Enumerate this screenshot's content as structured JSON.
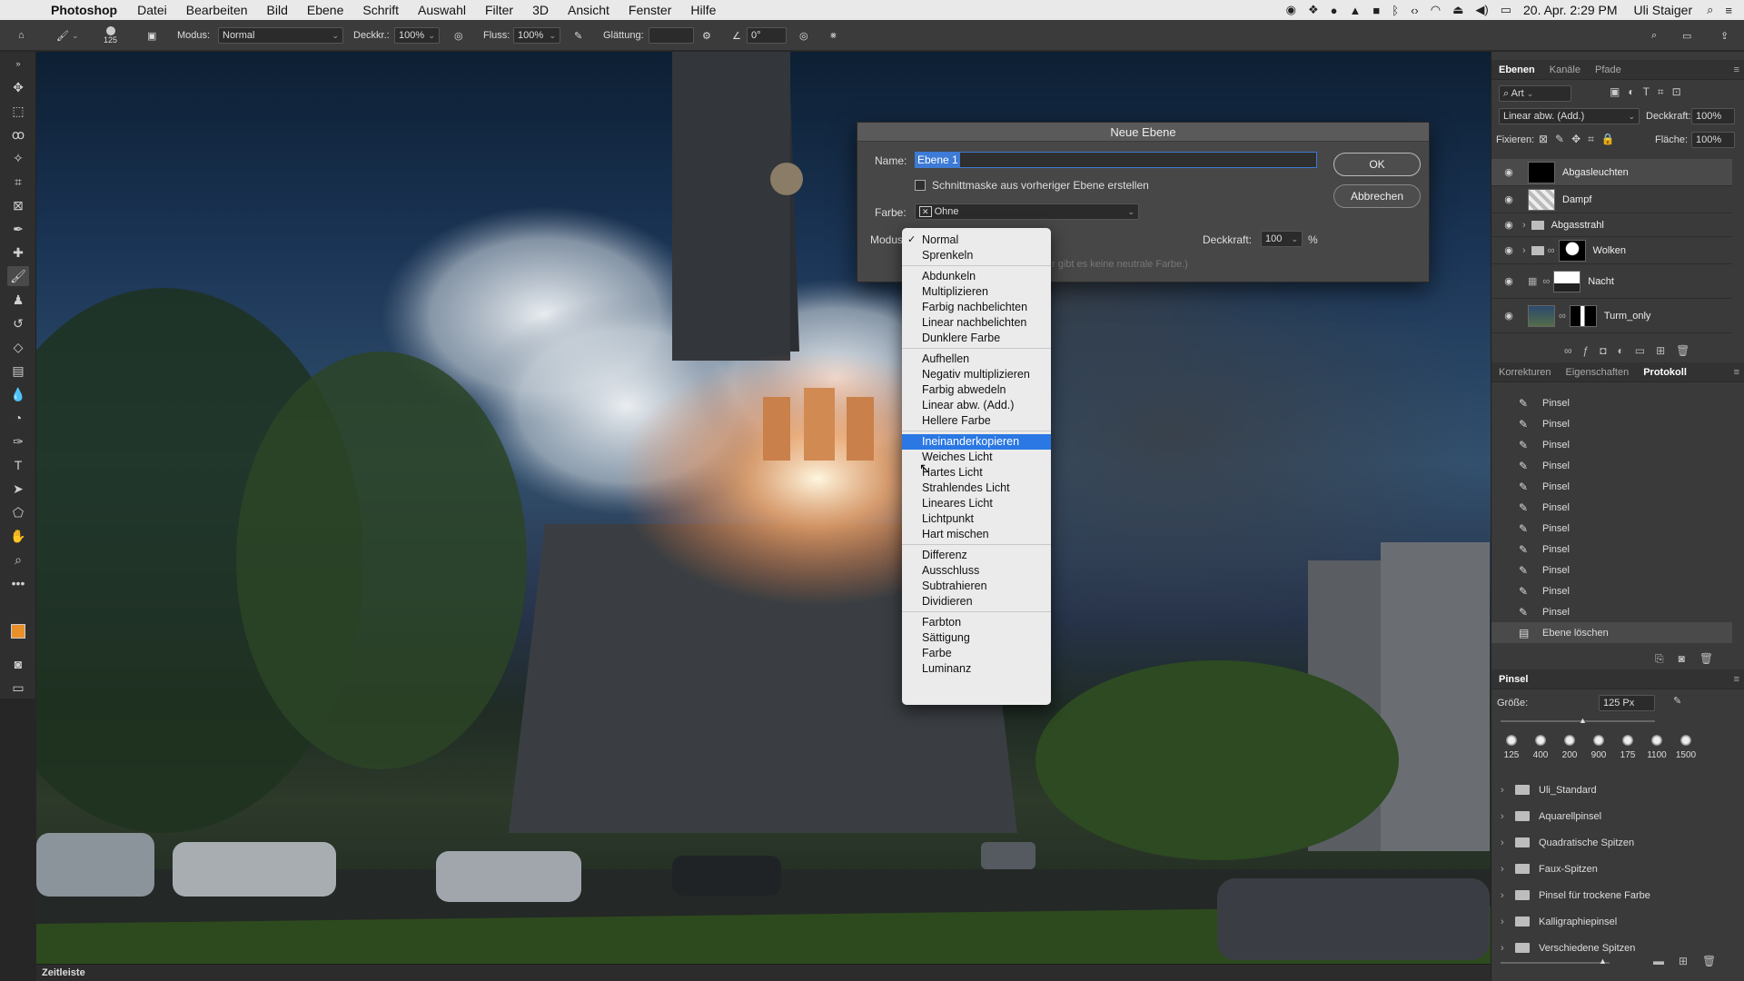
{
  "menubar": {
    "app": "Photoshop",
    "items": [
      "Datei",
      "Bearbeiten",
      "Bild",
      "Ebene",
      "Schrift",
      "Auswahl",
      "Filter",
      "3D",
      "Ansicht",
      "Fenster",
      "Hilfe"
    ],
    "date": "20. Apr.  2:29 PM",
    "user": "Uli Staiger"
  },
  "options": {
    "brush_size": "125",
    "modus_label": "Modus:",
    "modus_value": "Normal",
    "deckkr_label": "Deckkr.:",
    "deckkr_value": "100%",
    "fluss_label": "Fluss:",
    "fluss_value": "100%",
    "glaettung_label": "Glättung:",
    "angle_value": "0°"
  },
  "timeline": {
    "label": "Zeitleiste"
  },
  "layers_panel": {
    "tabs": [
      "Ebenen",
      "Kanäle",
      "Pfade"
    ],
    "filter": "Art",
    "blend": "Linear abw. (Add.)",
    "opacity_label": "Deckkraft:",
    "opacity_value": "100%",
    "lock_label": "Fixieren:",
    "fill_label": "Fläche:",
    "fill_value": "100%",
    "layers": [
      {
        "name": "Abgasleuchten"
      },
      {
        "name": "Dampf"
      },
      {
        "name": "Abgasstrahl"
      },
      {
        "name": "Wolken"
      },
      {
        "name": "Nacht"
      },
      {
        "name": "Turm_only"
      }
    ]
  },
  "history_panel": {
    "tabs": [
      "Korrekturen",
      "Eigenschaften",
      "Protokoll"
    ],
    "items": [
      "Pinsel",
      "Pinsel",
      "Pinsel",
      "Pinsel",
      "Pinsel",
      "Pinsel",
      "Pinsel",
      "Pinsel",
      "Pinsel",
      "Pinsel",
      "Pinsel",
      "Ebene löschen"
    ]
  },
  "brush_panel": {
    "title": "Pinsel",
    "size_label": "Größe:",
    "size_value": "125 Px",
    "presets": [
      "125",
      "400",
      "200",
      "900",
      "175",
      "1100",
      "1500"
    ],
    "folders": [
      "Uli_Standard",
      "Aquarellpinsel",
      "Quadratische Spitzen",
      "Faux-Spitzen",
      "Pinsel für trockene Farbe",
      "Kalligraphiepinsel",
      "Verschiedene Spitzen"
    ]
  },
  "dialog": {
    "title": "Neue Ebene",
    "name_label": "Name:",
    "name_value": "Ebene 1",
    "clip_label": "Schnittmaske aus vorheriger Ebene erstellen",
    "color_label": "Farbe:",
    "color_value": "Ohne",
    "mode_label": "Modus",
    "opacity_label": "Deckkraft:",
    "opacity_value": "100",
    "percent": "%",
    "neutral_note": "r gibt es keine neutrale Farbe.)",
    "ok": "OK",
    "cancel": "Abbrechen"
  },
  "blend_modes": {
    "selected": "Normal",
    "highlighted": "Ineinanderkopieren",
    "groups": [
      [
        "Normal",
        "Sprenkeln"
      ],
      [
        "Abdunkeln",
        "Multiplizieren",
        "Farbig nachbelichten",
        "Linear nachbelichten",
        "Dunklere Farbe"
      ],
      [
        "Aufhellen",
        "Negativ multiplizieren",
        "Farbig abwedeln",
        "Linear abw. (Add.)",
        "Hellere Farbe"
      ],
      [
        "Ineinanderkopieren",
        "Weiches Licht",
        "Hartes Licht",
        "Strahlendes Licht",
        "Lineares Licht",
        "Lichtpunkt",
        "Hart mischen"
      ],
      [
        "Differenz",
        "Ausschluss",
        "Subtrahieren",
        "Dividieren"
      ],
      [
        "Farbton",
        "Sättigung",
        "Farbe",
        "Luminanz"
      ]
    ]
  },
  "colors": {
    "accent": "#2b78e4",
    "foreground": "#e8902a",
    "background": "#111111"
  }
}
